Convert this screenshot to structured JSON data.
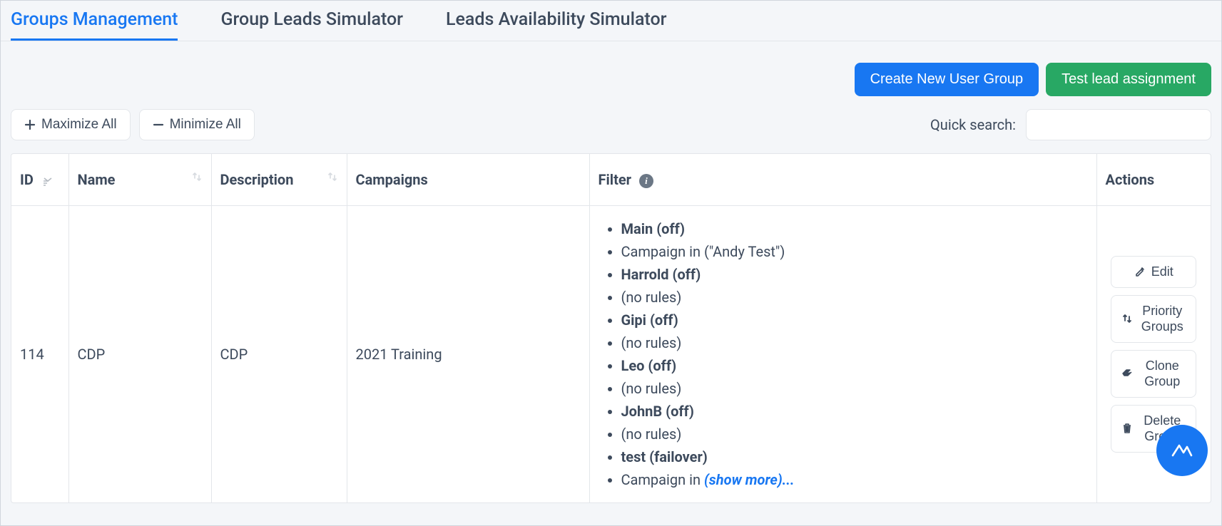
{
  "tabs": [
    {
      "label": "Groups Management",
      "active": true
    },
    {
      "label": "Group Leads Simulator",
      "active": false
    },
    {
      "label": "Leads Availability Simulator",
      "active": false
    }
  ],
  "actions": {
    "create_group": "Create New User Group",
    "test_lead": "Test lead assignment"
  },
  "toolbar": {
    "maximize": "Maximize All",
    "minimize": "Minimize All",
    "search_label": "Quick search:"
  },
  "columns": {
    "id": "ID",
    "name": "Name",
    "description": "Description",
    "campaigns": "Campaigns",
    "filter": "Filter",
    "actions": "Actions"
  },
  "row": {
    "id": "114",
    "name": "CDP",
    "description": "CDP",
    "campaigns": "2021 Training",
    "filters": [
      {
        "text": "Main (off)",
        "bold": true
      },
      {
        "text": "Campaign in (\"Andy Test\")",
        "bold": false
      },
      {
        "text": "Harrold (off)",
        "bold": true
      },
      {
        "text": "(no rules)",
        "bold": false
      },
      {
        "text": "Gipi (off)",
        "bold": true
      },
      {
        "text": "(no rules)",
        "bold": false
      },
      {
        "text": "Leo (off)",
        "bold": true
      },
      {
        "text": "(no rules)",
        "bold": false
      },
      {
        "text": "JohnB (off)",
        "bold": true
      },
      {
        "text": "(no rules)",
        "bold": false
      },
      {
        "text": "test (failover)",
        "bold": true
      }
    ],
    "filter_last_prefix": "Campaign in ",
    "show_more": "(show more)...",
    "row_actions": {
      "edit": "Edit",
      "priority": "Priority Groups",
      "clone": "Clone Group",
      "delete": "Delete Group"
    }
  }
}
